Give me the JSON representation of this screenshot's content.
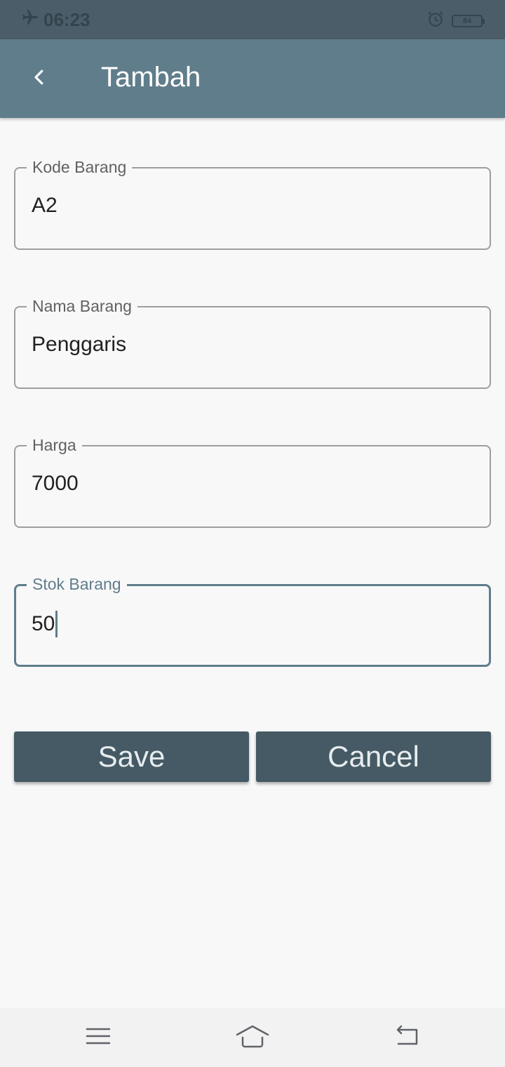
{
  "status_bar": {
    "time": "06:23",
    "battery": "84",
    "icons": [
      "airplane-mode-icon",
      "alarm-icon",
      "battery-icon"
    ]
  },
  "app_bar": {
    "title": "Tambah",
    "back_icon": "chevron-left-icon"
  },
  "form": {
    "kode_barang": {
      "label": "Kode Barang",
      "value": "A2"
    },
    "nama_barang": {
      "label": "Nama Barang",
      "value": "Penggaris"
    },
    "harga": {
      "label": "Harga",
      "value": "7000"
    },
    "stok_barang": {
      "label": "Stok Barang",
      "value": "50",
      "focused": true
    }
  },
  "actions": {
    "save_label": "Save",
    "cancel_label": "Cancel"
  },
  "nav_bar": {
    "icons": [
      "menu-icon",
      "home-icon",
      "back-icon"
    ]
  },
  "colors": {
    "status_bar": "#4a5d69",
    "app_bar": "#607d8b",
    "button": "#455a64",
    "background": "#f8f8f9",
    "focus": "#607d8b"
  }
}
